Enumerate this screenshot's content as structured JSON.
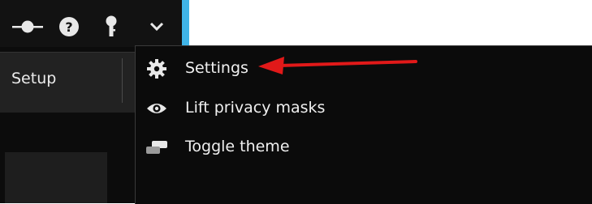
{
  "colors": {
    "accent": "#3fb4e8",
    "background": "#0c0c0c",
    "menu_background": "#0b0b0b",
    "text": "#f0f0f0",
    "annotation": "#e11919"
  },
  "titlebar": {
    "icons": [
      "connection-icon",
      "help-icon",
      "pin-icon",
      "chevron-down-icon"
    ]
  },
  "tabs": {
    "setup_label": "Setup"
  },
  "menu": {
    "items": [
      {
        "label": "Settings",
        "icon": "gear-icon"
      },
      {
        "label": "Lift privacy masks",
        "icon": "eye-icon"
      },
      {
        "label": "Toggle theme",
        "icon": "toggle-theme-icon"
      }
    ]
  }
}
